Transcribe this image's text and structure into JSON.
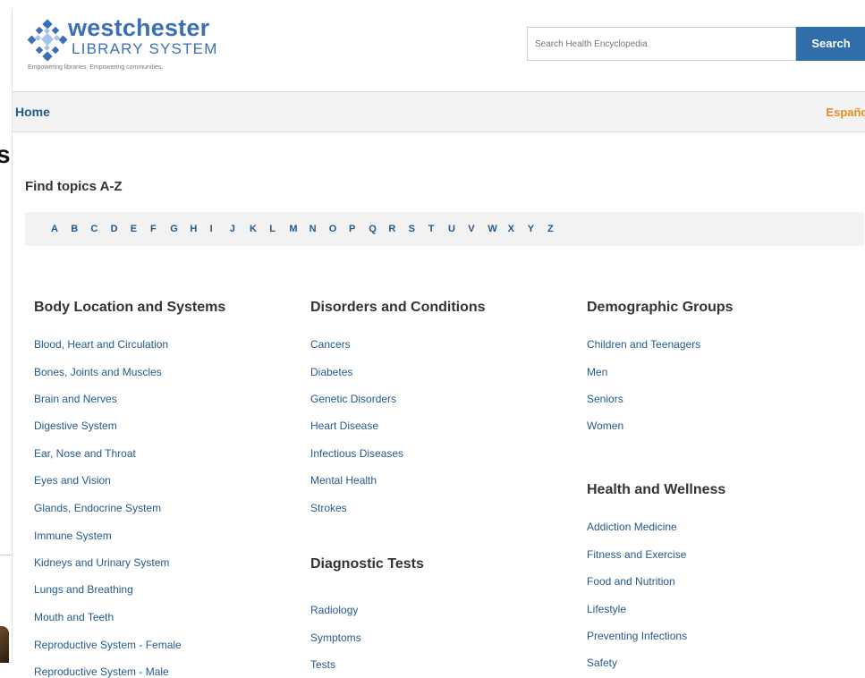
{
  "logo": {
    "title": "westchester",
    "subtitle": "LIBRARY SYSTEM",
    "tagline": "Empowering libraries. Empowering communities."
  },
  "search": {
    "placeholder": "Search Health Encyclopedia",
    "button_label": "Search"
  },
  "nav": {
    "home_label": "Home",
    "language_label": "Español"
  },
  "left_strip": {
    "text": "s"
  },
  "az": {
    "title": "Find topics A-Z",
    "letters": [
      "A",
      "B",
      "C",
      "D",
      "E",
      "F",
      "G",
      "H",
      "I",
      "J",
      "K",
      "L",
      "M",
      "N",
      "O",
      "P",
      "Q",
      "R",
      "S",
      "T",
      "U",
      "V",
      "W",
      "X",
      "Y",
      "Z"
    ]
  },
  "categories": {
    "body": {
      "title": "Body Location and Systems",
      "items": [
        "Blood, Heart and Circulation",
        "Bones, Joints and Muscles",
        "Brain and Nerves",
        "Digestive System",
        "Ear, Nose and Throat",
        "Eyes and Vision",
        "Glands, Endocrine System",
        "Immune System",
        "Kidneys and Urinary System",
        "Lungs and Breathing",
        "Mouth and Teeth",
        "Reproductive System - Female",
        "Reproductive System - Male"
      ]
    },
    "disorders": {
      "title": "Disorders and Conditions",
      "items": [
        "Cancers",
        "Diabetes",
        "Genetic Disorders",
        "Heart Disease",
        "Infectious Diseases",
        "Mental Health",
        "Strokes"
      ]
    },
    "diagnostic": {
      "title": "Diagnostic Tests",
      "items": [
        "Radiology",
        "Symptoms",
        "Tests"
      ]
    },
    "demographic": {
      "title": "Demographic Groups",
      "items": [
        "Children and Teenagers",
        "Men",
        "Seniors",
        "Women"
      ]
    },
    "wellness": {
      "title": "Health and Wellness",
      "items": [
        "Addiction Medicine",
        "Fitness and Exercise",
        "Food and Nutrition",
        "Lifestyle",
        "Preventing Infections",
        "Safety"
      ]
    }
  },
  "colors": {
    "link": "#235a8c",
    "search_button": "#2f6ea8",
    "language_link": "#e58a1f",
    "logo": "#3b6fb6"
  }
}
